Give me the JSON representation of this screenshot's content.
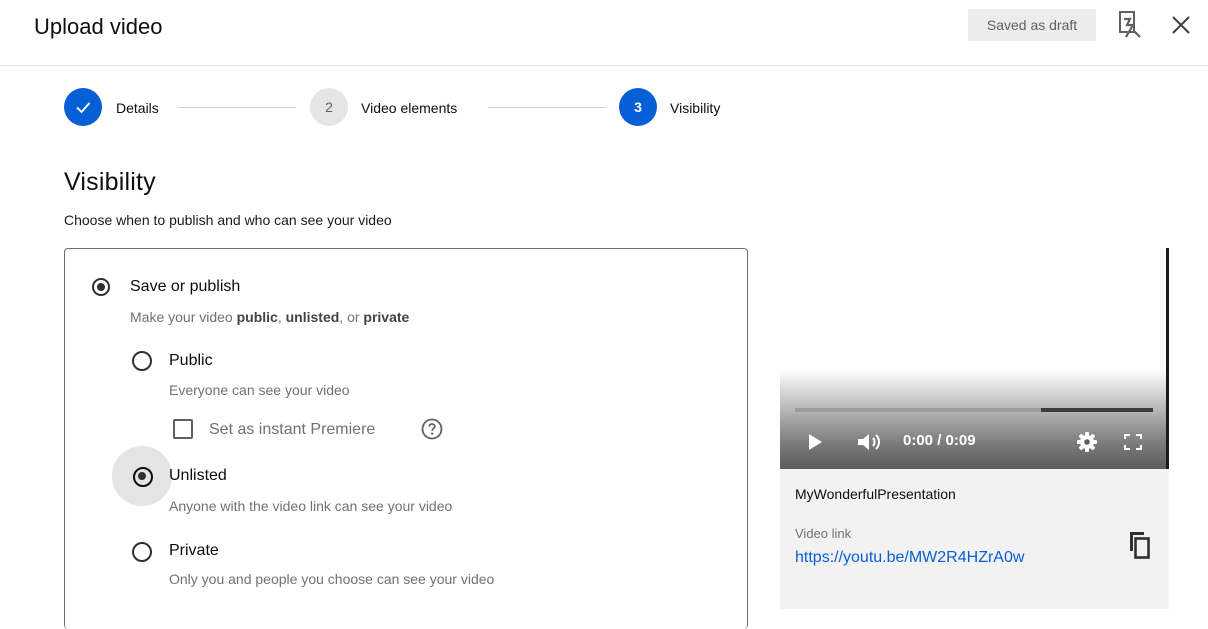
{
  "header": {
    "title": "Upload video",
    "draft_status": "Saved as draft"
  },
  "stepper": {
    "steps": [
      {
        "number": "✓",
        "label": "Details",
        "state": "done"
      },
      {
        "number": "2",
        "label": "Video elements",
        "state": "pending"
      },
      {
        "number": "3",
        "label": "Visibility",
        "state": "current"
      }
    ]
  },
  "visibility": {
    "heading": "Visibility",
    "subtitle": "Choose when to publish and who can see your video",
    "save_or_publish": {
      "label": "Save or publish",
      "desc_prefix": "Make your video ",
      "desc_public": "public",
      "desc_sep1": ", ",
      "desc_unlisted": "unlisted",
      "desc_sep2": ", or ",
      "desc_private": "private",
      "selected": true
    },
    "options": [
      {
        "label": "Public",
        "desc": "Everyone can see your video",
        "selected": false
      },
      {
        "label": "Unlisted",
        "desc": "Anyone with the video link can see your video",
        "selected": true
      },
      {
        "label": "Private",
        "desc": "Only you and people you choose can see your video",
        "selected": false
      }
    ],
    "premiere": {
      "label": "Set as instant Premiere",
      "checked": false
    }
  },
  "video": {
    "time": "0:00 / 0:09",
    "progress": 0.0,
    "file_name": "MyWonderfulPresentation",
    "link_label": "Video link",
    "link_url": "https://youtu.be/MW2R4HZrA0w"
  },
  "colors": {
    "accent": "#065fd4",
    "step_pending": "#e5e5e5",
    "draft_bg": "#ececec"
  },
  "icons": [
    "report-icon",
    "close-icon",
    "check-icon",
    "help-icon",
    "play-icon",
    "volume-icon",
    "settings-icon",
    "fullscreen-icon",
    "copy-icon"
  ]
}
